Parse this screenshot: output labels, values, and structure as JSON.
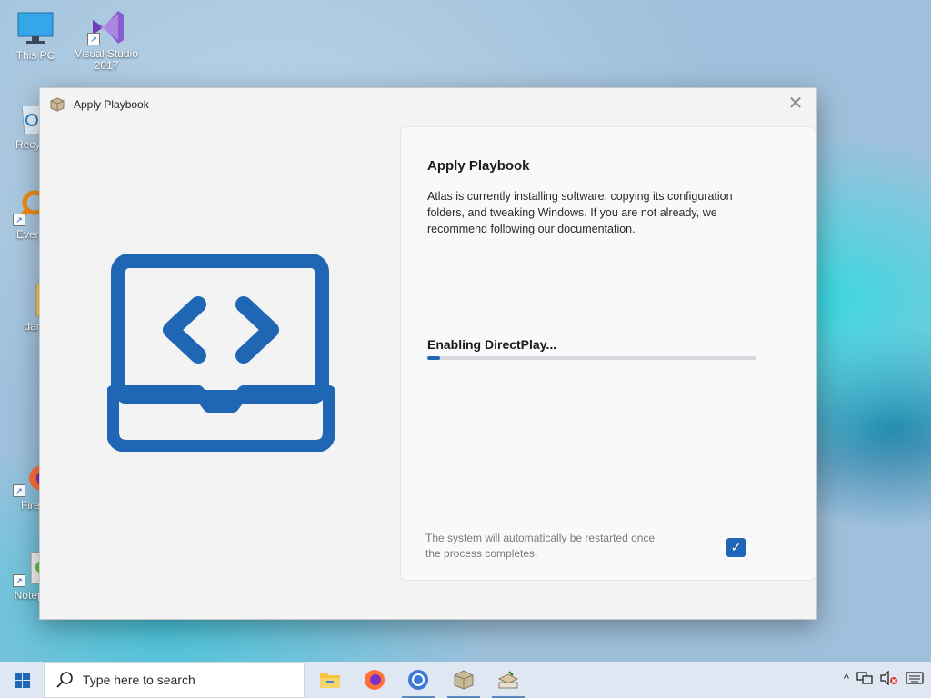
{
  "desktop": {
    "icons": [
      {
        "label": "This PC",
        "icon": "this-pc-icon"
      },
      {
        "label": "Visual Studio\n2017",
        "icon": "visual-studio-icon"
      },
      {
        "label": "Recycl",
        "icon": "recycle-bin-icon"
      },
      {
        "label": "Everyt",
        "icon": "everything-icon"
      },
      {
        "label": "dar",
        "icon": "folder-icon"
      },
      {
        "label": "Firef",
        "icon": "firefox-icon"
      },
      {
        "label": "Notepa",
        "icon": "notepad-icon"
      }
    ]
  },
  "window": {
    "title": "Apply Playbook",
    "close_glyph": "✕",
    "heading": "Apply Playbook",
    "description": "Atlas is currently installing software, copying its configuration folders, and tweaking Windows. If you are not already, we recommend following our documentation.",
    "status": "Enabling DirectPlay...",
    "progress_percent": 4,
    "restart_note": "The system will automatically be restarted once the process completes.",
    "restart_checked": true,
    "accent_color": "#1f66b5"
  },
  "taskbar": {
    "search_placeholder": "Type here to search",
    "apps": [
      "file-explorer-icon",
      "firefox-icon",
      "chrome-icon",
      "package-icon",
      "installer-icon"
    ],
    "tray_chevron": "^"
  }
}
